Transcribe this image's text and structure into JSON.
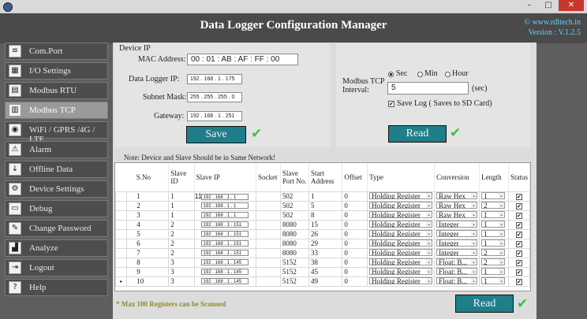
{
  "window": {
    "minimize": "–",
    "maximize": "□",
    "close": "✕"
  },
  "header": {
    "title": "Data Logger Configuration Manager",
    "website": "© www.rdltech.in",
    "version": "Version : V.1.2.5"
  },
  "sidebar": {
    "items": [
      {
        "label": "Com.Port",
        "icon": "com-port-icon",
        "glyph": "≡"
      },
      {
        "label": "I/O Settings",
        "icon": "io-settings-icon",
        "glyph": "▦"
      },
      {
        "label": "Modbus RTU",
        "icon": "modbus-rtu-icon",
        "glyph": "▤"
      },
      {
        "label": "Modbus TCP",
        "icon": "modbus-tcp-icon",
        "glyph": "▥"
      },
      {
        "label": "WiFi / GPRS /4G / LTE",
        "icon": "wifi-icon",
        "glyph": "◉"
      },
      {
        "label": "Alarm",
        "icon": "alarm-icon",
        "glyph": "⚠"
      },
      {
        "label": "Offline Data",
        "icon": "offline-data-icon",
        "glyph": "↓"
      },
      {
        "label": "Device Settings",
        "icon": "device-settings-icon",
        "glyph": "⚙"
      },
      {
        "label": "Debug",
        "icon": "debug-icon",
        "glyph": "▭"
      },
      {
        "label": "Change Password",
        "icon": "change-password-icon",
        "glyph": "✎"
      },
      {
        "label": "Analyze",
        "icon": "analyze-icon",
        "glyph": "▟"
      },
      {
        "label": "Logout",
        "icon": "logout-icon",
        "glyph": "⇥"
      },
      {
        "label": "Help",
        "icon": "help-icon",
        "glyph": "?"
      }
    ],
    "active": "Modbus TCP"
  },
  "device_ip": {
    "heading": "Device IP",
    "mac_label": "MAC Address:",
    "mac_value": "00 : 01 : AB : AF : FF : 00",
    "ip_label": "Data Logger IP:",
    "ip_value": "192 . 168 . 1 . 175",
    "subnet_label": "Subnet Mask:",
    "subnet_value": "255 . 255 . 255 . 0",
    "gateway_label": "Gateway:",
    "gateway_value": "192 . 168 . 1 . 251",
    "save_label": "Save"
  },
  "interval": {
    "label": "Modbus TCP Interval:",
    "options": [
      "Sec",
      "Min",
      "Hour"
    ],
    "selected": "Sec",
    "value": "5",
    "unit": "(sec)",
    "save_log_label": "Save Log ( Saves to SD Card)",
    "save_log_checked": true,
    "read_label": "Read"
  },
  "note": "Note: Device and Slave Should be in Same Network!",
  "table": {
    "headers": [
      "S.No",
      "Slave ID",
      "Slave IP",
      "Socket",
      "Slave Port No.",
      "Start Address",
      "Offset",
      "Type",
      "Conversion",
      "Length",
      "Status"
    ],
    "rows": [
      {
        "sno": "1",
        "slave_id": "1",
        "prefix": "11",
        "ip": "192 . 168 . 1 . 1",
        "port": "502",
        "start": "1",
        "offset": "0",
        "type": "Holding Register",
        "conversion": "Raw Hex",
        "length": "1",
        "status": "✔"
      },
      {
        "sno": "2",
        "slave_id": "1",
        "prefix": "",
        "ip": "192 . 168 . 1 . 1",
        "port": "502",
        "start": "5",
        "offset": "0",
        "type": "Holding Register",
        "conversion": "Raw Hex",
        "length": "2",
        "status": "✔"
      },
      {
        "sno": "3",
        "slave_id": "1",
        "prefix": "",
        "ip": "192 . 168 . 1 . 1",
        "port": "502",
        "start": "8",
        "offset": "0",
        "type": "Holding Register",
        "conversion": "Raw Hex",
        "length": "1",
        "status": "✔"
      },
      {
        "sno": "4",
        "slave_id": "2",
        "prefix": "",
        "ip": "192 . 168 . 1 . 151",
        "port": "8080",
        "start": "15",
        "offset": "0",
        "type": "Holding Register",
        "conversion": "Integer",
        "length": "1",
        "status": "✔"
      },
      {
        "sno": "5",
        "slave_id": "2",
        "prefix": "",
        "ip": "192 . 168 . 1 . 151",
        "port": "8080",
        "start": "26",
        "offset": "0",
        "type": "Holding Register",
        "conversion": "Integer",
        "length": "1",
        "status": "✔"
      },
      {
        "sno": "6",
        "slave_id": "2",
        "prefix": "",
        "ip": "192 . 168 . 1 . 151",
        "port": "8080",
        "start": "29",
        "offset": "0",
        "type": "Holding Register",
        "conversion": "Integer",
        "length": "1",
        "status": "✔"
      },
      {
        "sno": "7",
        "slave_id": "2",
        "prefix": "",
        "ip": "192 . 168 . 1 . 151",
        "port": "8080",
        "start": "33",
        "offset": "0",
        "type": "Holding Register",
        "conversion": "Integer",
        "length": "2",
        "status": "✔"
      },
      {
        "sno": "8",
        "slave_id": "3",
        "prefix": "",
        "ip": "192 . 168 . 1 . 145",
        "port": "5152",
        "start": "38",
        "offset": "0",
        "type": "Holding Register",
        "conversion": "Float: B...",
        "length": "2",
        "status": "✔"
      },
      {
        "sno": "9",
        "slave_id": "3",
        "prefix": "",
        "ip": "192 . 168 . 1 . 145",
        "port": "5152",
        "start": "45",
        "offset": "0",
        "type": "Holding Register",
        "conversion": "Float: B...",
        "length": "1",
        "status": "✔"
      },
      {
        "sno": "10",
        "slave_id": "3",
        "prefix": "",
        "ip": "192 . 168 . 1 . 145",
        "port": "5152",
        "start": "49",
        "offset": "0",
        "type": "Holding Register",
        "conversion": "Float: B...",
        "length": "1",
        "status": "✔"
      }
    ],
    "current_row_marker": "▸"
  },
  "footer": {
    "max_note": "* Max 100 Registers can be Scanned",
    "read_label": "Read"
  },
  "colors": {
    "accent": "#1e7e8a",
    "check": "#3fbf3f",
    "website": "#5fd1ff",
    "close": "#c7372e"
  }
}
